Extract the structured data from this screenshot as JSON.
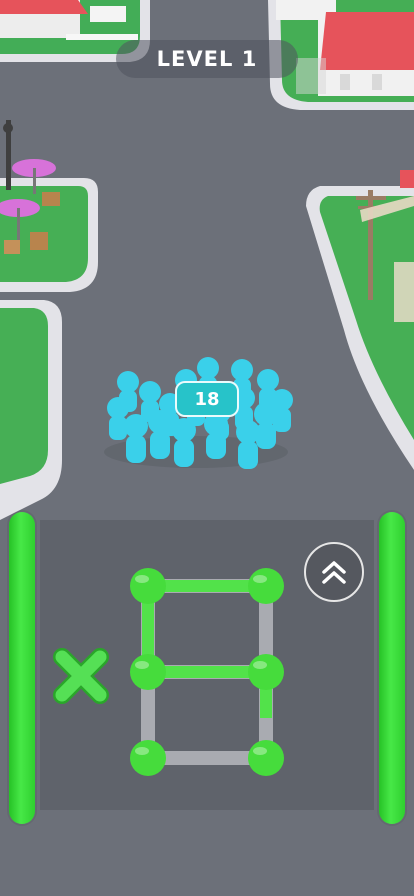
{
  "hud": {
    "level_label": "LEVEL 1"
  },
  "crowd": {
    "count": "18"
  },
  "controls": {
    "multiplier_icon": "x-icon",
    "boost_icon": "double-chevron-up-icon"
  },
  "colors": {
    "road": "#6c7079",
    "grass": "#46b05a",
    "curb": "#e6e6ea",
    "crowd": "#3ad0ea",
    "badge": "#27c3c9",
    "drawing": "#52e24a",
    "node": "#46dc3c",
    "pad": "#5f636b"
  }
}
